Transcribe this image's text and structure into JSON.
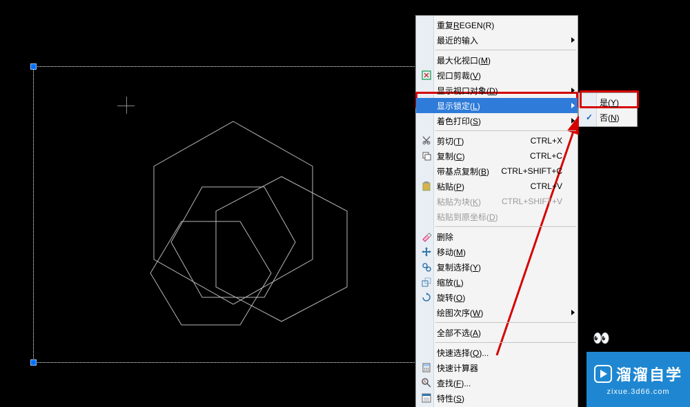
{
  "menu": {
    "items": [
      {
        "label": "重复REGEN(R)",
        "u": "R",
        "icon": null
      },
      {
        "label": "最近的输入",
        "icon": null,
        "submenu": true
      },
      {
        "sep": true
      },
      {
        "label": "最大化视口(M)",
        "u": "M",
        "icon": null
      },
      {
        "label": "视口剪裁(V)",
        "u": "V",
        "icon": "clip"
      },
      {
        "label": "显示视口对象(D)",
        "u": "D",
        "icon": null,
        "submenu": true
      },
      {
        "label": "显示锁定(L)",
        "u": "L",
        "icon": null,
        "submenu": true,
        "highlight": true
      },
      {
        "label": "着色打印(S)",
        "u": "S",
        "icon": null,
        "submenu": true
      },
      {
        "sep": true
      },
      {
        "label": "剪切(T)",
        "u": "T",
        "icon": "cut",
        "shortcut": "CTRL+X"
      },
      {
        "label": "复制(C)",
        "u": "C",
        "icon": "copy",
        "shortcut": "CTRL+C"
      },
      {
        "label": "带基点复制(B)",
        "u": "B",
        "icon": null,
        "shortcut": "CTRL+SHIFT+C"
      },
      {
        "label": "粘贴(P)",
        "u": "P",
        "icon": "paste",
        "shortcut": "CTRL+V"
      },
      {
        "label": "粘贴为块(K)",
        "u": "K",
        "icon": null,
        "shortcut": "CTRL+SHIFT+V",
        "disabled": true
      },
      {
        "label": "粘贴到原坐标(D)",
        "u": "D",
        "icon": null,
        "disabled": true
      },
      {
        "sep": true
      },
      {
        "label": "删除",
        "icon": "erase"
      },
      {
        "label": "移动(M)",
        "u": "M",
        "icon": "move"
      },
      {
        "label": "复制选择(Y)",
        "u": "Y",
        "icon": "copysel"
      },
      {
        "label": "缩放(L)",
        "u": "L",
        "icon": "scale"
      },
      {
        "label": "旋转(O)",
        "u": "O",
        "icon": "rotate"
      },
      {
        "label": "绘图次序(W)",
        "u": "W",
        "icon": null,
        "submenu": true
      },
      {
        "sep": true
      },
      {
        "label": "全部不选(A)",
        "u": "A",
        "icon": null
      },
      {
        "sep": true
      },
      {
        "label": "快速选择(Q)...",
        "u": "Q",
        "icon": null
      },
      {
        "label": "快速计算器",
        "icon": "calc"
      },
      {
        "label": "查找(F)...",
        "u": "F",
        "icon": "find"
      },
      {
        "label": "特性(S)",
        "u": "S",
        "icon": "props"
      }
    ]
  },
  "submenu": {
    "items": [
      {
        "label": "是(Y)",
        "u": "Y"
      },
      {
        "label": "否(N)",
        "u": "N",
        "checked": true
      }
    ]
  },
  "watermark": {
    "brand": "溜溜自学",
    "url": "zixue.3d66.com"
  },
  "colors": {
    "highlight": "#2f7bd9",
    "red": "#d60000",
    "wm": "#1f87d1"
  }
}
